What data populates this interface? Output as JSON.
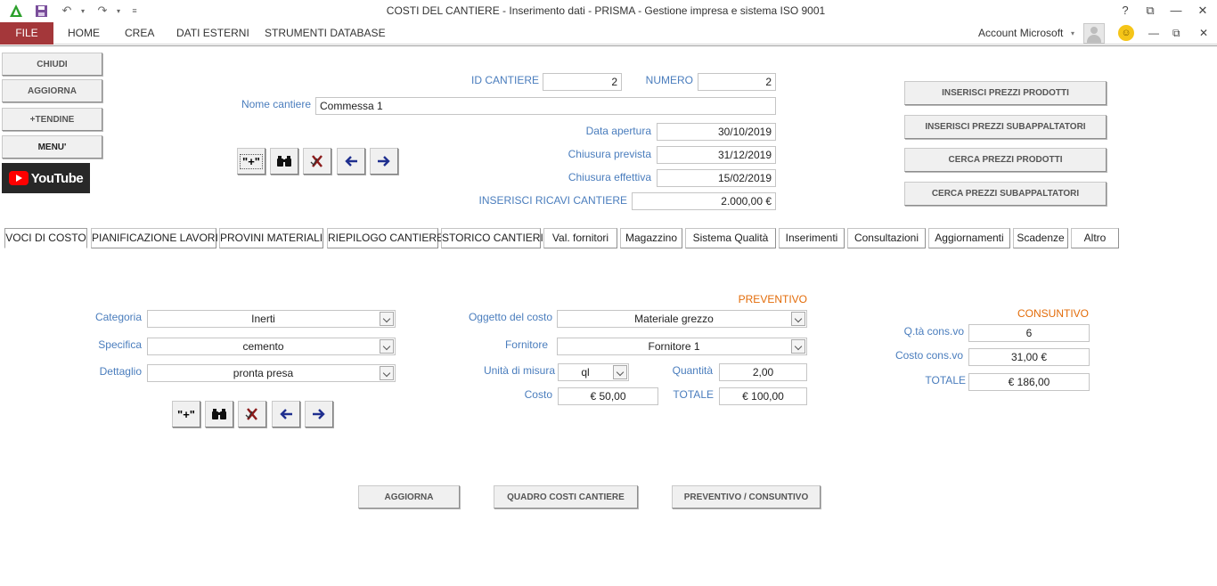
{
  "window": {
    "title": "COSTI DEL CANTIERE - Inserimento dati - PRISMA - Gestione impresa e sistema ISO 9001",
    "help": "?",
    "account": "Account Microsoft"
  },
  "ribbon": {
    "file": "FILE",
    "tabs": [
      "HOME",
      "CREA",
      "DATI ESTERNI",
      "STRUMENTI DATABASE"
    ]
  },
  "left_buttons": {
    "close": "CHIUDI",
    "refresh": "AGGIORNA",
    "tendine": "+TENDINE",
    "menu": "MENU'",
    "youtube": "YouTube"
  },
  "header": {
    "id_cantiere_label": "ID CANTIERE",
    "id_cantiere": "2",
    "numero_label": "NUMERO",
    "numero": "2",
    "nome_label": "Nome cantiere",
    "nome": "Commessa 1",
    "data_apertura_label": "Data apertura",
    "data_apertura": "30/10/2019",
    "chiusura_prevista_label": "Chiusura prevista",
    "chiusura_prevista": "31/12/2019",
    "chiusura_effettiva_label": "Chiusura effettiva",
    "chiusura_effettiva": "15/02/2019",
    "ricavi_label": "INSERISCI RICAVI CANTIERE",
    "ricavi": "2.000,00 €"
  },
  "nav_add_label": "\"+\"",
  "right_buttons": {
    "prezzi_prodotti": "INSERISCI PREZZI PRODOTTI",
    "prezzi_sub": "INSERISCI PREZZI SUBAPPALTATORI",
    "cerca_prodotti": "CERCA PREZZI PRODOTTI",
    "cerca_sub": "CERCA PREZZI SUBAPPALTATORI"
  },
  "tabs": [
    "VOCI DI COSTO",
    "PIANIFICAZIONE LAVORI",
    "PROVINI MATERIALI",
    "RIEPILOGO CANTIERE",
    "STORICO CANTIERI",
    "Val. fornitori",
    "Magazzino",
    "Sistema Qualità",
    "Inserimenti",
    "Consultazioni",
    "Aggiornamenti",
    "Scadenze",
    "Altro"
  ],
  "voci": {
    "categoria_label": "Categoria",
    "categoria": "Inerti",
    "specifica_label": "Specifica",
    "specifica": "cemento",
    "dettaglio_label": "Dettaglio",
    "dettaglio": "pronta presa",
    "preventivo_label": "PREVENTIVO",
    "oggetto_label": "Oggetto del costo",
    "oggetto": "Materiale grezzo",
    "fornitore_label": "Fornitore",
    "fornitore": "Fornitore 1",
    "unita_label": "Unità di misura",
    "unita": "ql",
    "quantita_label": "Quantità",
    "quantita": "2,00",
    "costo_label": "Costo",
    "costo": "€ 50,00",
    "totale_label": "TOTALE",
    "totale": "€ 100,00",
    "consuntivo_label": "CONSUNTIVO",
    "qta_cons_label": "Q.tà cons.vo",
    "qta_cons": "6",
    "costo_cons_label": "Costo cons.vo",
    "costo_cons": "31,00 €",
    "totale_cons_label": "TOTALE",
    "totale_cons": "€ 186,00"
  },
  "bottom_buttons": {
    "aggiorna": "AGGIORNA",
    "quadro": "QUADRO COSTI CANTIERE",
    "prev_cons": "PREVENTIVO / CONSUNTIVO"
  }
}
